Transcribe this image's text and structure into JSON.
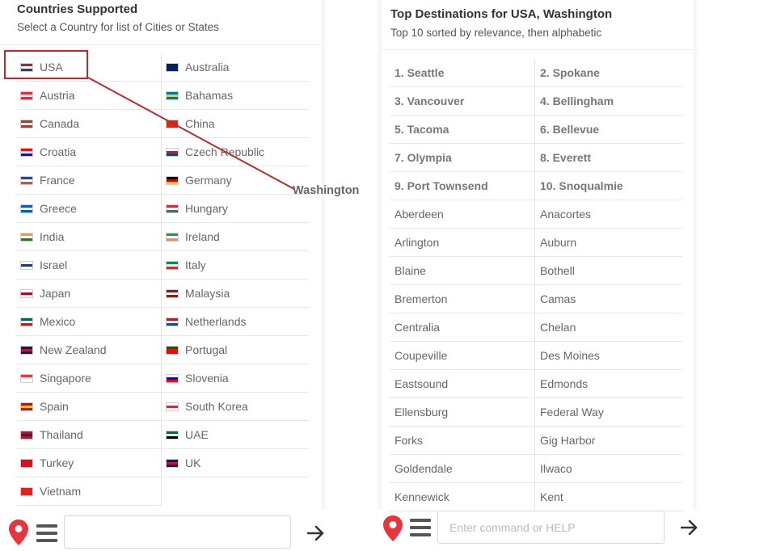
{
  "countries_panel": {
    "title": "Countries Supported",
    "subtitle": "Select a Country for list of Cities or States",
    "columns": [
      [
        {
          "name": "USA",
          "flag": "flag-usa-icon",
          "colors": [
            "#b22234",
            "#ffffff",
            "#3c3b6e"
          ]
        },
        {
          "name": "Austria",
          "flag": "flag-austria-icon",
          "colors": [
            "#ed2939",
            "#ffffff",
            "#ed2939"
          ]
        },
        {
          "name": "Canada",
          "flag": "flag-canada-icon",
          "colors": [
            "#d52b1e",
            "#ffffff",
            "#d52b1e"
          ]
        },
        {
          "name": "Croatia",
          "flag": "flag-croatia-icon",
          "colors": [
            "#ff0000",
            "#ffffff",
            "#171796"
          ]
        },
        {
          "name": "France",
          "flag": "flag-france-icon",
          "colors": [
            "#0055a4",
            "#ffffff",
            "#ef4135"
          ]
        },
        {
          "name": "Greece",
          "flag": "flag-greece-icon",
          "colors": [
            "#0d5eaf",
            "#ffffff",
            "#0d5eaf"
          ]
        },
        {
          "name": "India",
          "flag": "flag-india-icon",
          "colors": [
            "#ff9933",
            "#ffffff",
            "#138808"
          ]
        },
        {
          "name": "Israel",
          "flag": "flag-israel-icon",
          "colors": [
            "#ffffff",
            "#0038b8",
            "#ffffff"
          ]
        },
        {
          "name": "Japan",
          "flag": "flag-japan-icon",
          "colors": [
            "#ffffff",
            "#bc002d",
            "#ffffff"
          ]
        },
        {
          "name": "Mexico",
          "flag": "flag-mexico-icon",
          "colors": [
            "#006847",
            "#ffffff",
            "#ce1126"
          ]
        },
        {
          "name": "New Zealand",
          "flag": "flag-new-zealand-icon",
          "colors": [
            "#012169",
            "#c8102e",
            "#012169"
          ]
        },
        {
          "name": "Singapore",
          "flag": "flag-singapore-icon",
          "colors": [
            "#ef3340",
            "#ffffff",
            "#ffffff"
          ]
        },
        {
          "name": "Spain",
          "flag": "flag-spain-icon",
          "colors": [
            "#c60b1e",
            "#ffc400",
            "#c60b1e"
          ]
        },
        {
          "name": "Thailand",
          "flag": "flag-thailand-icon",
          "colors": [
            "#a51931",
            "#2d2a4a",
            "#a51931"
          ]
        },
        {
          "name": "Turkey",
          "flag": "flag-turkey-icon",
          "colors": [
            "#e30a17",
            "#e30a17",
            "#e30a17"
          ]
        },
        {
          "name": "Vietnam",
          "flag": "flag-vietnam-icon",
          "colors": [
            "#da251d",
            "#da251d",
            "#da251d"
          ]
        }
      ],
      [
        {
          "name": "Australia",
          "flag": "flag-australia-icon",
          "colors": [
            "#012169",
            "#012169",
            "#012169"
          ]
        },
        {
          "name": "Bahamas",
          "flag": "flag-bahamas-icon",
          "colors": [
            "#00778b",
            "#ffc72c",
            "#00778b"
          ]
        },
        {
          "name": "China",
          "flag": "flag-china-icon",
          "colors": [
            "#de2910",
            "#de2910",
            "#de2910"
          ]
        },
        {
          "name": "Czech Republic",
          "flag": "flag-czech-republic-icon",
          "colors": [
            "#ffffff",
            "#d7141a",
            "#11457e"
          ]
        },
        {
          "name": "Germany",
          "flag": "flag-germany-icon",
          "colors": [
            "#000000",
            "#dd0000",
            "#ffce00"
          ]
        },
        {
          "name": "Hungary",
          "flag": "flag-hungary-icon",
          "colors": [
            "#cd2a3e",
            "#ffffff",
            "#436f4d"
          ]
        },
        {
          "name": "Ireland",
          "flag": "flag-ireland-icon",
          "colors": [
            "#169b62",
            "#ffffff",
            "#ff883e"
          ]
        },
        {
          "name": "Italy",
          "flag": "flag-italy-icon",
          "colors": [
            "#009246",
            "#ffffff",
            "#ce2b37"
          ]
        },
        {
          "name": "Malaysia",
          "flag": "flag-malaysia-icon",
          "colors": [
            "#cc0001",
            "#ffffff",
            "#cc0001"
          ]
        },
        {
          "name": "Netherlands",
          "flag": "flag-netherlands-icon",
          "colors": [
            "#ae1c28",
            "#ffffff",
            "#21468b"
          ]
        },
        {
          "name": "Portugal",
          "flag": "flag-portugal-icon",
          "colors": [
            "#006600",
            "#ff0000",
            "#ff0000"
          ]
        },
        {
          "name": "Slovenia",
          "flag": "flag-slovenia-icon",
          "colors": [
            "#ffffff",
            "#0000ff",
            "#ff0000"
          ]
        },
        {
          "name": "South Korea",
          "flag": "flag-south-korea-icon",
          "colors": [
            "#ffffff",
            "#cd2e3a",
            "#ffffff"
          ]
        },
        {
          "name": "UAE",
          "flag": "flag-uae-icon",
          "colors": [
            "#00732f",
            "#ffffff",
            "#000000"
          ]
        },
        {
          "name": "UK",
          "flag": "flag-uk-icon",
          "colors": [
            "#012169",
            "#c8102e",
            "#012169"
          ]
        }
      ]
    ]
  },
  "annotation": {
    "label": "Washington",
    "color": "#c0282e"
  },
  "destinations_panel": {
    "title": "Top Destinations for USA, Washington",
    "subtitle": "Top 10 sorted by relevance, then alphabetic",
    "rows": [
      [
        "1. Seattle",
        "2. Spokane"
      ],
      [
        "3. Vancouver",
        "4. Bellingham"
      ],
      [
        "5. Tacoma",
        "6. Bellevue"
      ],
      [
        "7. Olympia",
        "8. Everett"
      ],
      [
        "9. Port Townsend",
        "10. Snoqualmie"
      ],
      [
        "Aberdeen",
        "Anacortes"
      ],
      [
        "Arlington",
        "Auburn"
      ],
      [
        "Blaine",
        "Bothell"
      ],
      [
        "Bremerton",
        "Camas"
      ],
      [
        "Centralia",
        "Chelan"
      ],
      [
        "Coupeville",
        "Des Moines"
      ],
      [
        "Eastsound",
        "Edmonds"
      ],
      [
        "Ellensburg",
        "Federal Way"
      ],
      [
        "Forks",
        "Gig Harbor"
      ],
      [
        "Goldendale",
        "Ilwaco"
      ],
      [
        "Kennewick",
        "Kent"
      ]
    ],
    "top_count": 10
  },
  "command_bars": {
    "left": {
      "value": "",
      "placeholder": ""
    },
    "right": {
      "value": "",
      "placeholder": "Enter command or HELP"
    },
    "pin_color": "#e8343c",
    "icon_color": "#555555"
  }
}
